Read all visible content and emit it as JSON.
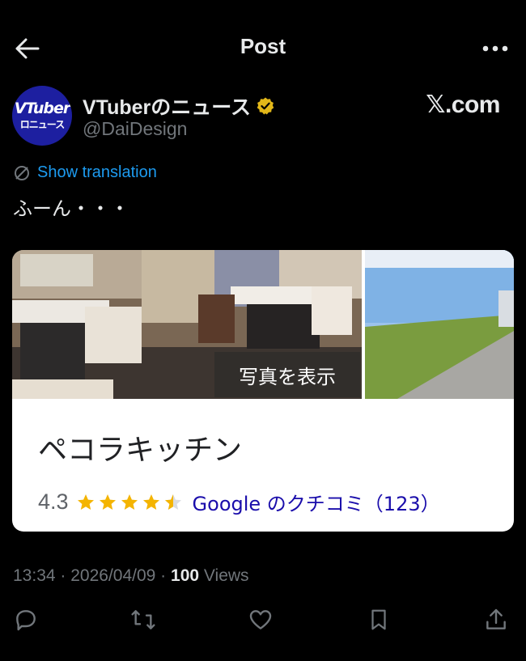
{
  "header": {
    "title": "Post",
    "back_icon": "arrow-left-icon",
    "more_icon": "ellipsis-icon"
  },
  "author": {
    "avatar_line1": "VTuber",
    "avatar_line2": "ロニュース",
    "display_name": "VTuberのニュース",
    "handle": "@DaiDesign",
    "verified_badge_color": "#e2b719"
  },
  "watermark": "𝕏.com",
  "post": {
    "translation_link": "Show translation",
    "text": "ふーん・・・"
  },
  "card": {
    "photo_label": "写真を表示",
    "place_name": "ペコラキッチン",
    "rating": "4.3",
    "rating_stars_fraction": 0.86,
    "review_label": "Google のクチコミ（123）"
  },
  "meta": {
    "time": "13:34",
    "date": "2026/04/09",
    "views_count": "100",
    "views_label": "Views",
    "separator": " · "
  },
  "actions": [
    "reply-icon",
    "repost-icon",
    "like-icon",
    "bookmark-icon",
    "share-icon"
  ],
  "colors": {
    "accent": "#1d9bf0",
    "background": "#000000",
    "text": "#e7e9ea",
    "muted": "#71767b",
    "star": "#f4b400"
  }
}
